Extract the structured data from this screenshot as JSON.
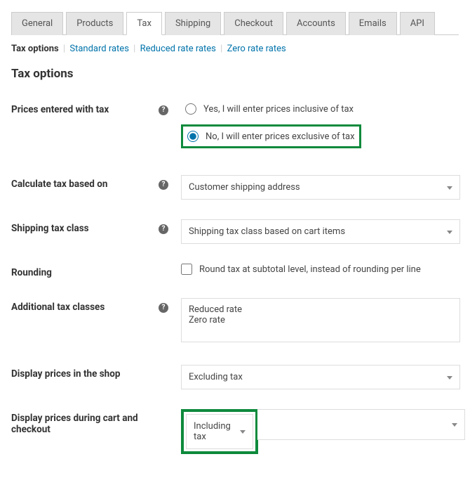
{
  "tabs": {
    "general": "General",
    "products": "Products",
    "tax": "Tax",
    "shipping": "Shipping",
    "checkout": "Checkout",
    "accounts": "Accounts",
    "emails": "Emails",
    "api": "API"
  },
  "subnav": {
    "tax_options": "Tax options",
    "standard_rates": "Standard rates",
    "reduced_rate_rates": "Reduced rate rates",
    "zero_rate_rates": "Zero rate rates"
  },
  "heading": "Tax options",
  "form": {
    "prices_entered_with_tax": {
      "label": "Prices entered with tax",
      "option_yes": "Yes, I will enter prices inclusive of tax",
      "option_no": "No, I will enter prices exclusive of tax",
      "selected": "no"
    },
    "calculate_tax": {
      "label": "Calculate tax based on",
      "value": "Customer shipping address"
    },
    "shipping_tax_class": {
      "label": "Shipping tax class",
      "value": "Shipping tax class based on cart items"
    },
    "rounding": {
      "label": "Rounding",
      "option": "Round tax at subtotal level, instead of rounding per line",
      "checked": false
    },
    "additional_tax_classes": {
      "label": "Additional tax classes",
      "value": "Reduced rate\nZero rate"
    },
    "display_shop": {
      "label": "Display prices in the shop",
      "value": "Excluding tax"
    },
    "display_cart": {
      "label": "Display prices during cart and checkout",
      "value": "Including tax"
    }
  }
}
